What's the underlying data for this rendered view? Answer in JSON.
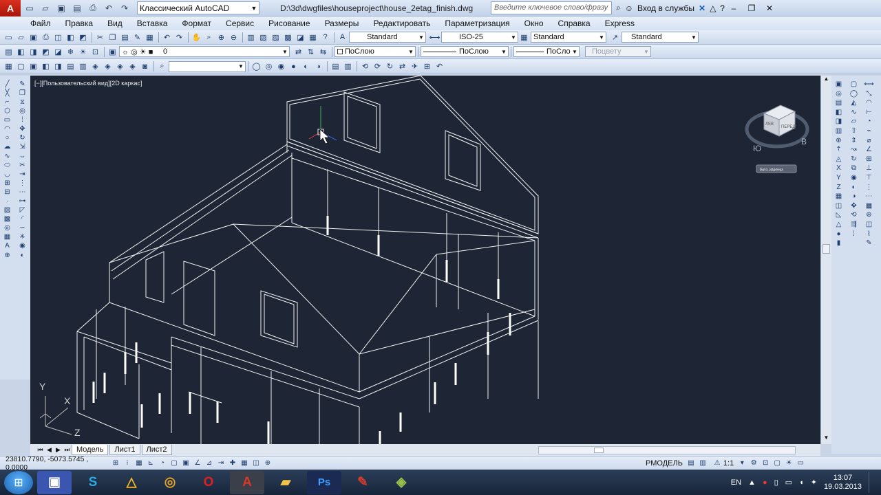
{
  "title_bar": {
    "logo": "A",
    "workspace": "Классический AutoCAD",
    "document_path": "D:\\3d\\dwgfiles\\houseproject\\house_2etag_finish.dwg",
    "search_placeholder": "Введите ключевое слово/фразу",
    "sign_in": "Вход в службы"
  },
  "menu": [
    "Файл",
    "Правка",
    "Вид",
    "Вставка",
    "Формат",
    "Сервис",
    "Рисование",
    "Размеры",
    "Редактировать",
    "Параметризация",
    "Окно",
    "Справка",
    "Express"
  ],
  "styles_toolbar": {
    "text_style": "Standard",
    "dim_style": "ISO-25",
    "table_style": "Standard",
    "multileader_style": "Standard"
  },
  "layers_toolbar": {
    "layer": "0",
    "color": "ПоСлою",
    "linetype": "ПоСлою",
    "lineweight": "ПоСлою",
    "plot_style": "Поцвету"
  },
  "viewport": {
    "label": "[−][Пользовательский вид][2D каркас]",
    "viewcube": {
      "left_face": "ЛЕВ",
      "front_face": "ПЕРЕД",
      "compass_south": "Ю",
      "compass_east": "В",
      "ucs_menu": "Без имени"
    },
    "ucs_axes": [
      "Y",
      "X",
      "Z"
    ]
  },
  "layout_tabs": [
    "Модель",
    "Лист1",
    "Лист2"
  ],
  "status_bar": {
    "coordinates": "23810.7790, -5073.5745 , 0.0000",
    "model_space": "РМОДЕЛЬ",
    "annotation_scale": "1:1"
  },
  "taskbar": {
    "language": "EN",
    "time": "13:07",
    "date": "19.03.2013"
  },
  "colors": {
    "canvas_bg": "#1e2635",
    "wire": "#ffffff",
    "ui_bg": "#d3deee",
    "taskbar_bg": "#1b2b42"
  }
}
